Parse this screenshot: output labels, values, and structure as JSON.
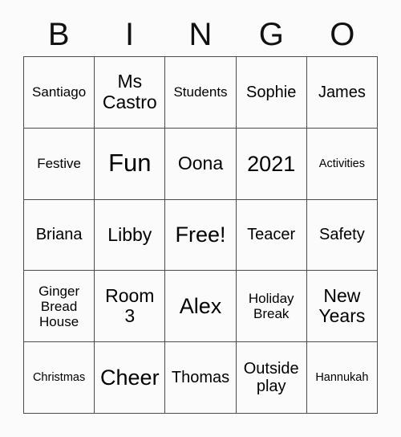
{
  "card": {
    "title": "BINGO",
    "header_letters": [
      "B",
      "I",
      "N",
      "G",
      "O"
    ],
    "free_space_label": "Free!",
    "colors": {
      "background": "#fbfbfb",
      "text": "#000000",
      "grid_line": "#4c4c4c"
    },
    "grid": {
      "columns": 5,
      "rows": 5,
      "cells": [
        [
          {
            "text": "Santiago",
            "size": "s"
          },
          {
            "text": "Ms\nCastro",
            "size": "l"
          },
          {
            "text": "Students",
            "size": "s"
          },
          {
            "text": "Sophie",
            "size": "m"
          },
          {
            "text": "James",
            "size": "m"
          }
        ],
        [
          {
            "text": "Festive",
            "size": "s"
          },
          {
            "text": "Fun",
            "size": "xxl"
          },
          {
            "text": "Oona",
            "size": "l"
          },
          {
            "text": "2021",
            "size": "xl"
          },
          {
            "text": "Activities",
            "size": "xs"
          }
        ],
        [
          {
            "text": "Briana",
            "size": "m"
          },
          {
            "text": "Libby",
            "size": "l"
          },
          {
            "text": "Free!",
            "size": "xl"
          },
          {
            "text": "Teacer",
            "size": "m"
          },
          {
            "text": "Safety",
            "size": "m"
          }
        ],
        [
          {
            "text": "Ginger\nBread\nHouse",
            "size": "s"
          },
          {
            "text": "Room\n3",
            "size": "l"
          },
          {
            "text": "Alex",
            "size": "xl"
          },
          {
            "text": "Holiday\nBreak",
            "size": "s"
          },
          {
            "text": "New\nYears",
            "size": "l"
          }
        ],
        [
          {
            "text": "Christmas",
            "size": "xs"
          },
          {
            "text": "Cheer",
            "size": "xl"
          },
          {
            "text": "Thomas",
            "size": "m"
          },
          {
            "text": "Outside\nplay",
            "size": "m"
          },
          {
            "text": "Hannukah",
            "size": "xs"
          }
        ]
      ]
    }
  }
}
